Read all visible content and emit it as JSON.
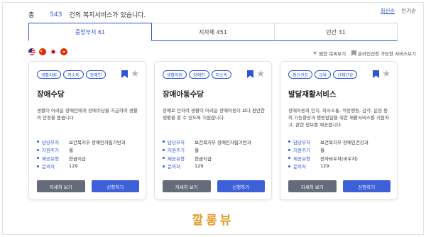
{
  "summary": {
    "prefix": "총",
    "count": "543",
    "suffix": "건의 복지서비스가 있습니다."
  },
  "sort": {
    "latest": "최신순",
    "popular": "인기순"
  },
  "tabs": [
    {
      "label": "중앙부처 61"
    },
    {
      "label": "지자체 451"
    },
    {
      "label": "민간 31"
    }
  ],
  "flags": [
    "us-flag-icon",
    "china-flag-icon",
    "japan-flag-icon",
    "vietnam-flag-icon"
  ],
  "legend": {
    "favorite": "찜한 목록보기",
    "online": "온라인신청 가능한 서비스보기"
  },
  "cards": [
    {
      "tags": [
        "생활지원",
        "저소득",
        "장애인"
      ],
      "title": "장애수당",
      "desc": "생활이 어려운 장애인에게 장애수당을 지급하여 생활의 안정을 돕습니다",
      "info": [
        {
          "k": "담당부처",
          "v": "보건복지부 장애인자립기반과"
        },
        {
          "k": "지원주기",
          "v": "월"
        },
        {
          "k": "제공유형",
          "v": "현금지급"
        },
        {
          "k": "문의처",
          "v": "129"
        }
      ],
      "detail": "자세히 보기",
      "apply": "신청하기"
    },
    {
      "tags": [
        "생활지원",
        "장애인",
        "저소득"
      ],
      "title": "장애아동수당",
      "desc": "장애로 인하여 생활이 어려운 장애아동이 보다 편안한 생활을 할 수 있도록 지원합니다.",
      "info": [
        {
          "k": "담당부처",
          "v": "보건복지부 장애인자립기반과"
        },
        {
          "k": "지원주기",
          "v": "월"
        },
        {
          "k": "제공유형",
          "v": "현금지급"
        },
        {
          "k": "문의처",
          "v": "129"
        }
      ],
      "detail": "자세히 보기",
      "apply": "신청하기"
    },
    {
      "tags": [
        "정신건강",
        "교육",
        "신체건강"
      ],
      "title": "발달재활서비스",
      "desc": "장애아동의 인지, 의사소통, 적응행동, 감각, 운동 등의 기능향상과 행동발달을 위한 재활서비스를 지원하고, 관련 정보를 제공합니다.",
      "info": [
        {
          "k": "담당부처",
          "v": "보건복지부 장애인건강과"
        },
        {
          "k": "지원주기",
          "v": "월"
        },
        {
          "k": "제공유형",
          "v": "전자바우처(바우처)"
        },
        {
          "k": "문의처",
          "v": "129"
        }
      ],
      "detail": "자세히 보기",
      "apply": "신청하기"
    }
  ],
  "watermark": "깔롱뷰",
  "colors": {
    "accent": "#2f55d4",
    "detail_button": "#666b7a",
    "apply_button": "#3d5fd8",
    "watermark": "#e39a2c"
  }
}
